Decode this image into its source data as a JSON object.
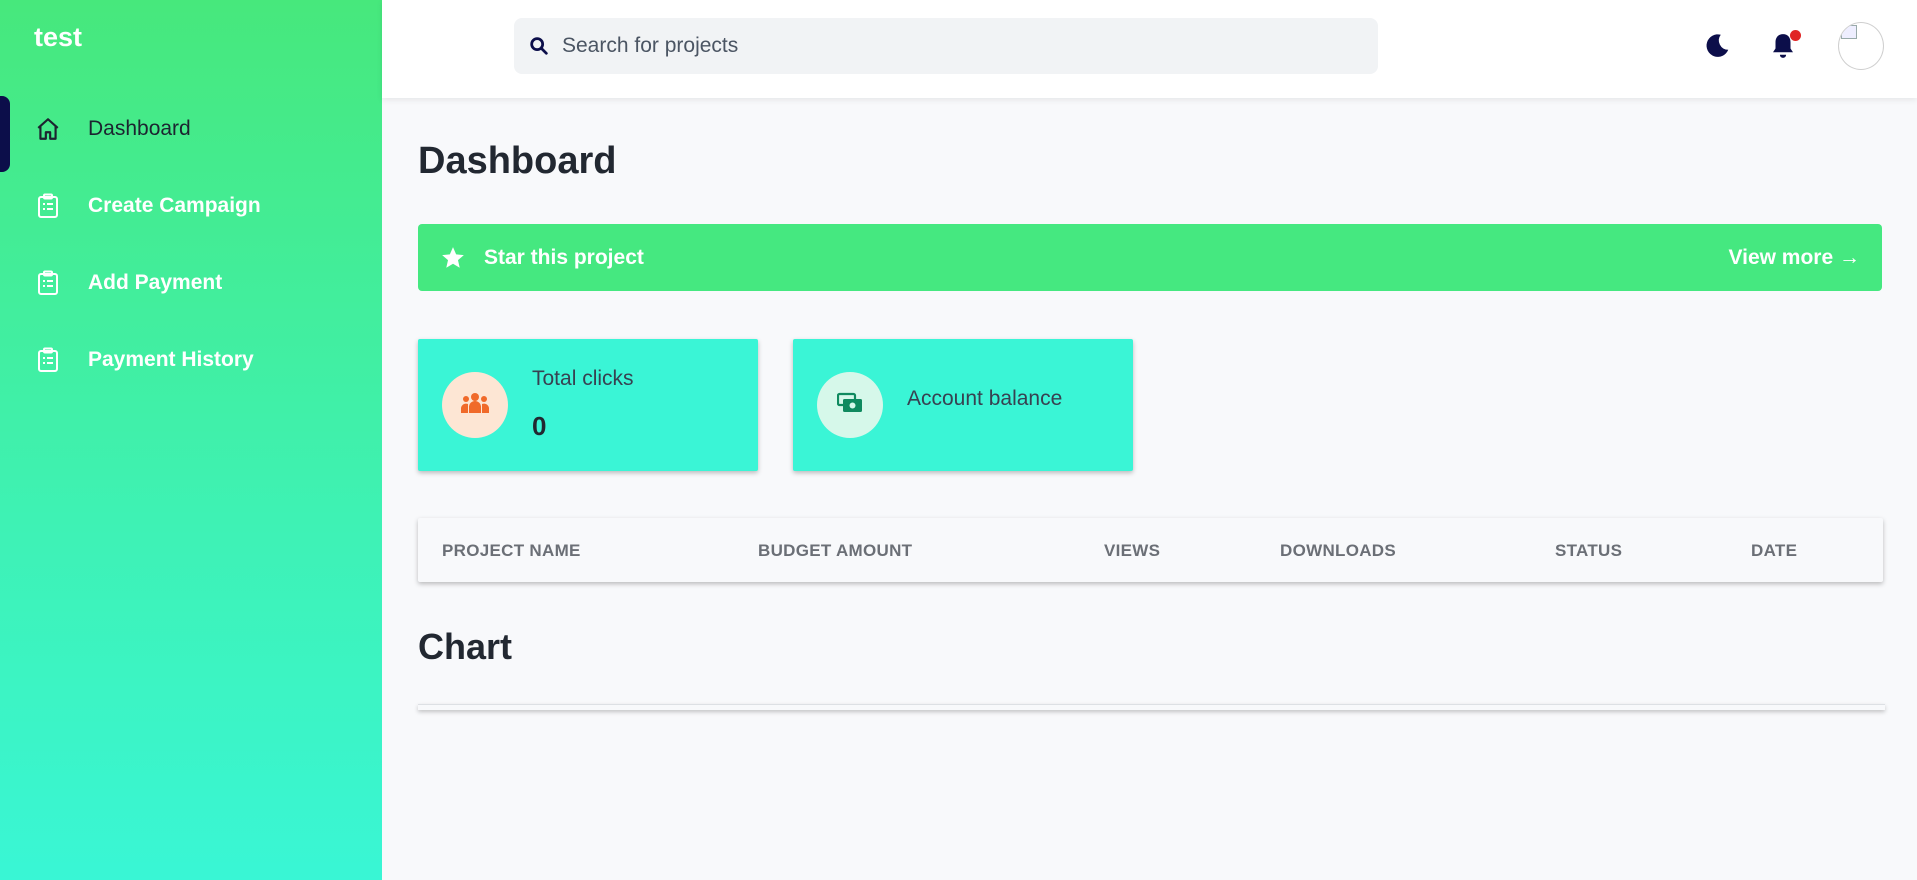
{
  "sidebar": {
    "brand": "test",
    "items": [
      {
        "label": "Dashboard",
        "icon": "home-icon",
        "active": true
      },
      {
        "label": "Create Campaign",
        "icon": "clipboard-icon",
        "active": false
      },
      {
        "label": "Add Payment",
        "icon": "clipboard-icon",
        "active": false
      },
      {
        "label": "Payment History",
        "icon": "clipboard-icon",
        "active": false
      }
    ]
  },
  "header": {
    "search_placeholder": "Search for projects",
    "icons": [
      "search-icon",
      "moon-icon",
      "bell-icon",
      "avatar"
    ]
  },
  "main": {
    "title": "Dashboard",
    "banner": {
      "text": "Star this project",
      "link": "View more →"
    },
    "cards": [
      {
        "label": "Total clicks",
        "value": "0",
        "icon": "users-icon"
      },
      {
        "label": "Account balance",
        "value": "",
        "icon": "money-icon"
      }
    ],
    "table": {
      "columns": [
        "PROJECT NAME",
        "BUDGET AMOUNT",
        "VIEWS",
        "DOWNLOADS",
        "STATUS",
        "DATE"
      ],
      "rows": []
    },
    "chart_title": "Chart"
  },
  "colors": {
    "sidebar_top": "#47e87c",
    "sidebar_bottom": "#39f6d5",
    "banner": "#45e880",
    "card": "#3af5d6",
    "active_indicator": "#0c0e4a",
    "notification_dot": "#e02424"
  }
}
